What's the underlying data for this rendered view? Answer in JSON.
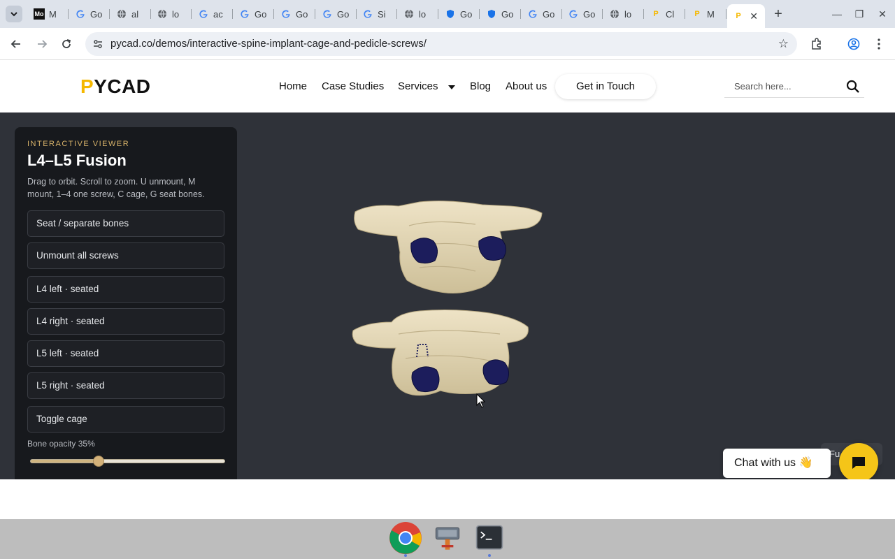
{
  "browser": {
    "tabs": [
      {
        "title": "M",
        "favicon": "Mo"
      },
      {
        "title": "Go",
        "favicon": "G"
      },
      {
        "title": "al",
        "favicon": "globe"
      },
      {
        "title": "lo",
        "favicon": "globe"
      },
      {
        "title": "ac",
        "favicon": "G"
      },
      {
        "title": "Go",
        "favicon": "G"
      },
      {
        "title": "Go",
        "favicon": "G"
      },
      {
        "title": "Go",
        "favicon": "G"
      },
      {
        "title": "Si",
        "favicon": "G"
      },
      {
        "title": "lo",
        "favicon": "globe"
      },
      {
        "title": "Go",
        "favicon": "shield"
      },
      {
        "title": "Go",
        "favicon": "shield"
      },
      {
        "title": "Go",
        "favicon": "G"
      },
      {
        "title": "Go",
        "favicon": "G"
      },
      {
        "title": "lo",
        "favicon": "globe"
      },
      {
        "title": "Cl",
        "favicon": "P"
      },
      {
        "title": "M",
        "favicon": "P"
      }
    ],
    "active_tab": {
      "favicon": "P"
    },
    "url": "pycad.co/demos/interactive-spine-implant-cage-and-pedicle-screws/"
  },
  "site": {
    "logo": {
      "first": "P",
      "rest": "YCAD"
    },
    "nav": {
      "home": "Home",
      "case_studies": "Case Studies",
      "services": "Services",
      "blog": "Blog",
      "about": "About us"
    },
    "cta": "Get in Touch",
    "search_placeholder": "Search here..."
  },
  "viewer": {
    "eyebrow": "INTERACTIVE VIEWER",
    "title": "L4–L5 Fusion",
    "description": "Drag to orbit. Scroll to zoom. U unmount, M mount, 1–4 one screw, C cage, G seat bones.",
    "buttons": {
      "seat": "Seat / separate bones",
      "unmount": "Unmount all screws",
      "l4_left": "L4 left · seated",
      "l4_right": "L4 right · seated",
      "l5_left": "L5 left · seated",
      "l5_right": "L5 right · seated",
      "cage": "Toggle cage"
    },
    "opacity_label": "Bone opacity 35%",
    "opacity_value": 0.35,
    "fullscreen_label": "Fu",
    "colors": {
      "bone": "#e3d6b4",
      "screw": "#1c1d5c",
      "background": "#2f3239",
      "accent": "#d8b36a"
    }
  },
  "chat": {
    "label": "Chat with us",
    "emoji": "👋",
    "brand_color": "#f5c518"
  },
  "dock": {
    "apps": [
      "chrome-icon",
      "disk-utility-icon",
      "terminal-icon"
    ]
  }
}
